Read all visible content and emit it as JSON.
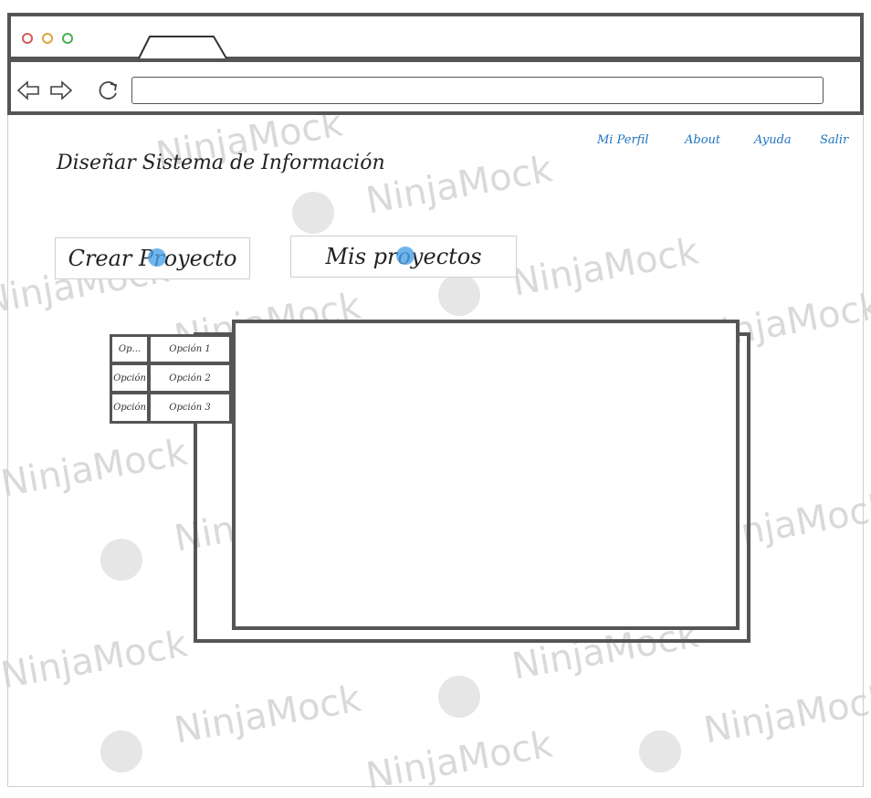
{
  "browser": {
    "window_buttons": [
      {
        "name": "close",
        "color": "#d45a5a"
      },
      {
        "name": "minimize",
        "color": "#e0a23a"
      },
      {
        "name": "maximize",
        "color": "#4caf50"
      }
    ],
    "address_value": ""
  },
  "header": {
    "nav_links": [
      "Mi Perfil",
      "About",
      "Ayuda",
      "Salir"
    ],
    "page_title": "Diseñar Sistema de Información"
  },
  "actions": {
    "create_project": "Crear Proyecto",
    "my_projects": "Mis proyectos"
  },
  "menu_grid": {
    "rows": [
      [
        "Op...",
        "Opción 1"
      ],
      [
        "Opción",
        "Opción 2"
      ],
      [
        "Opción",
        "Opción 3"
      ]
    ]
  },
  "watermark": {
    "text": "NinjaMock"
  },
  "colors": {
    "link": "#1f73c0",
    "border": "#555555",
    "click_marker": "#4da3ea"
  }
}
